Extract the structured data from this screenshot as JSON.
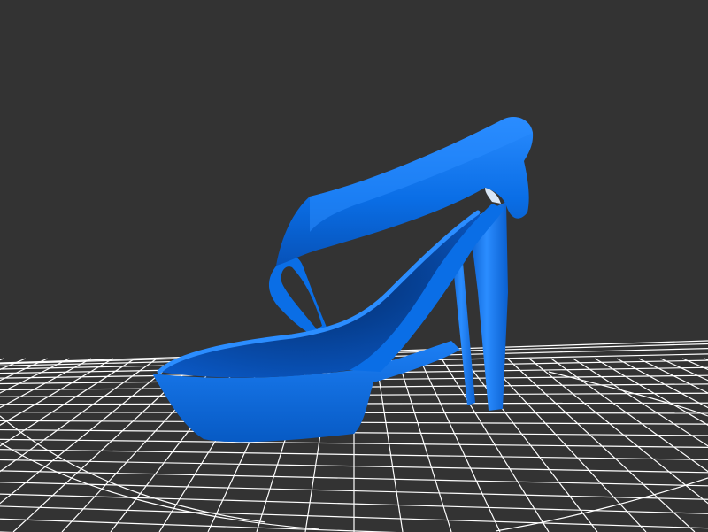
{
  "viewer": {
    "background_color": "#333333",
    "grid_color": "#ffffff",
    "model_color": "#0a6ee6",
    "model_icon": "high-heel-shoe-model"
  }
}
